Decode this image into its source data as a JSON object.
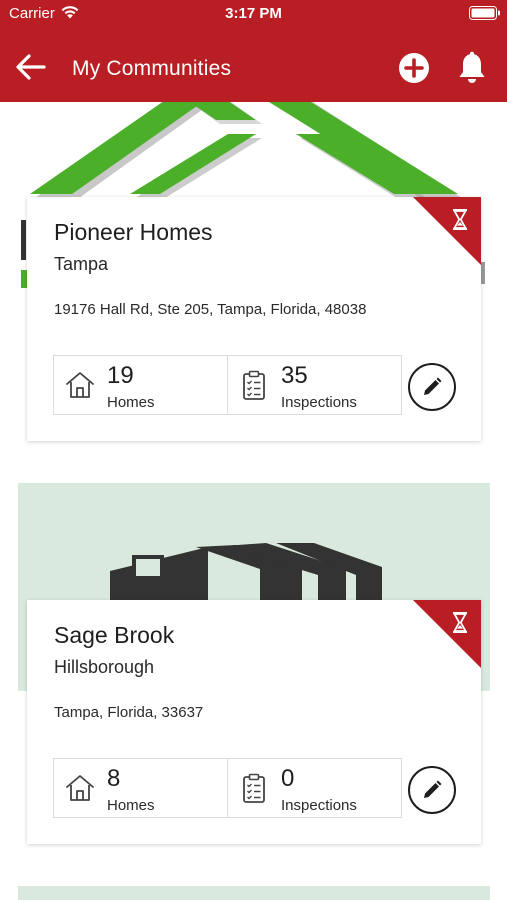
{
  "status_bar": {
    "carrier": "Carrier",
    "time": "3:17 PM"
  },
  "nav": {
    "title": "My Communities",
    "back_icon": "arrow-left-icon",
    "add_icon": "plus-circle-icon",
    "notifications_icon": "bell-icon"
  },
  "theme": {
    "brand_red": "#b81e23",
    "logo_green": "#4caf2a",
    "banner_mint": "#d9e9dd",
    "logo_dark": "#333333"
  },
  "communities": [
    {
      "name": "Pioneer Homes",
      "city": "Tampa",
      "address": "19176 Hall Rd, Ste 205, Tampa, Florida, 48038",
      "homes_count": "19",
      "homes_label": "Homes",
      "inspections_count": "35",
      "inspections_label": "Inspections",
      "status_icon": "hourglass-icon",
      "edit_icon": "pencil-icon"
    },
    {
      "name": "Sage Brook",
      "city": "Hillsborough",
      "address": "Tampa, Florida, 33637",
      "homes_count": "8",
      "homes_label": "Homes",
      "inspections_count": "0",
      "inspections_label": "Inspections",
      "status_icon": "hourglass-icon",
      "edit_icon": "pencil-icon"
    }
  ]
}
